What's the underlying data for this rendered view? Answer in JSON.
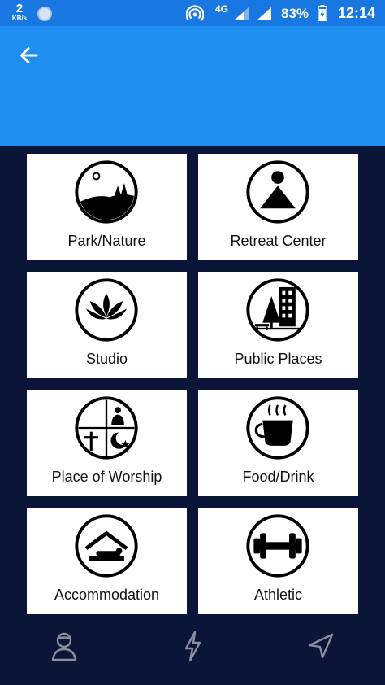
{
  "status_bar": {
    "speed_value": "2",
    "speed_unit": "KB/s",
    "network": "4G",
    "battery_percent": "83%",
    "time": "12:14"
  },
  "app_bar": {
    "back_icon": "arrow-left-icon",
    "color": "#1f8ef1"
  },
  "categories": [
    {
      "label": "Park/Nature",
      "icon": "park-nature-icon"
    },
    {
      "label": "Retreat Center",
      "icon": "retreat-center-icon"
    },
    {
      "label": "Studio",
      "icon": "lotus-icon"
    },
    {
      "label": "Public Places",
      "icon": "city-tree-icon"
    },
    {
      "label": "Place of Worship",
      "icon": "worship-icon"
    },
    {
      "label": "Food/Drink",
      "icon": "coffee-cup-icon"
    },
    {
      "label": "Accommodation",
      "icon": "bed-icon"
    },
    {
      "label": "Athletic",
      "icon": "dumbbell-icon"
    }
  ],
  "bottom_nav": {
    "items": [
      {
        "icon": "user-icon"
      },
      {
        "icon": "lightning-icon"
      },
      {
        "icon": "navigation-arrow-icon"
      }
    ]
  },
  "colors": {
    "status_bar": "#1877e0",
    "app_bar": "#1f8ef1",
    "background": "#0b1537",
    "tile": "#ffffff",
    "nav_icon": "#8a8f9e"
  }
}
